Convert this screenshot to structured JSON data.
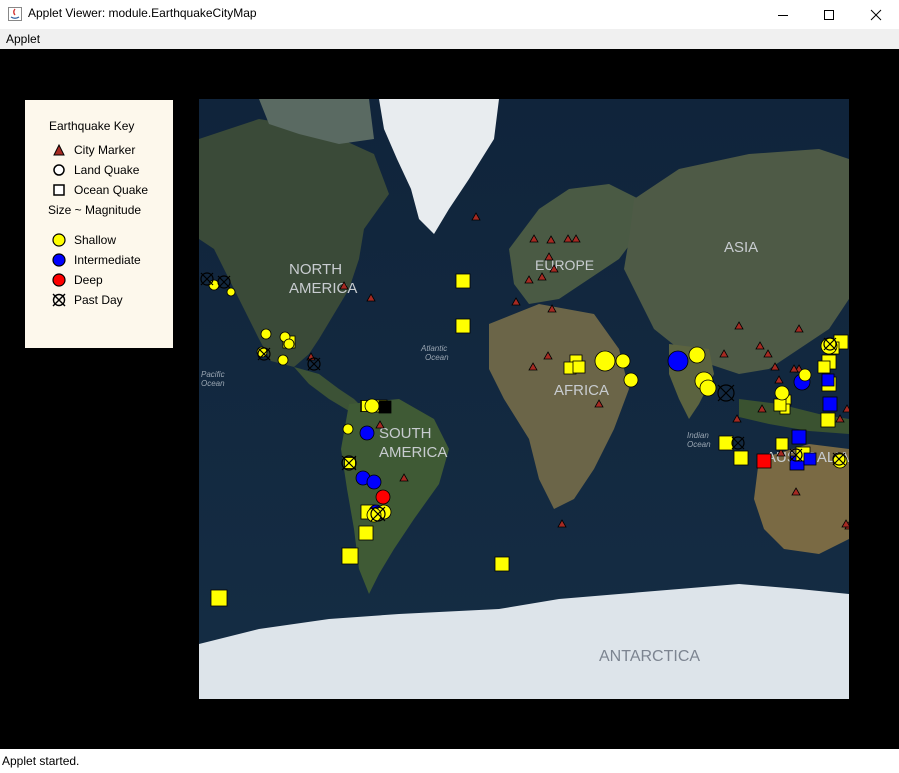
{
  "window": {
    "title": "Applet Viewer: module.EarthquakeCityMap"
  },
  "menu": {
    "applet": "Applet"
  },
  "key": {
    "title": "Earthquake Key",
    "city_marker": "City Marker",
    "land_quake": "Land Quake",
    "ocean_quake": "Ocean Quake",
    "size_note": "Size ~ Magnitude",
    "shallow": "Shallow",
    "intermediate": "Intermediate",
    "deep": "Deep",
    "past_day": "Past Day"
  },
  "map_labels": {
    "north_america_1": "NORTH",
    "north_america_2": "AMERICA",
    "europe": "EUROPE",
    "asia": "ASIA",
    "africa": "AFRICA",
    "south_america_1": "SOUTH",
    "south_america_2": "AMERICA",
    "australia": "AUSTRALIA",
    "antarctica": "ANTARCTICA",
    "atlantic_1": "Atlantic",
    "atlantic_2": "Ocean",
    "pacific_1": "Pacific",
    "pacific_2": "Ocean",
    "indian_1": "Indian",
    "indian_2": "Ocean"
  },
  "colors": {
    "shallow": "#ffff00",
    "intermediate": "#0000ff",
    "deep": "#ff0000",
    "city": "#a62a22"
  },
  "status": {
    "text": "Applet started."
  }
}
